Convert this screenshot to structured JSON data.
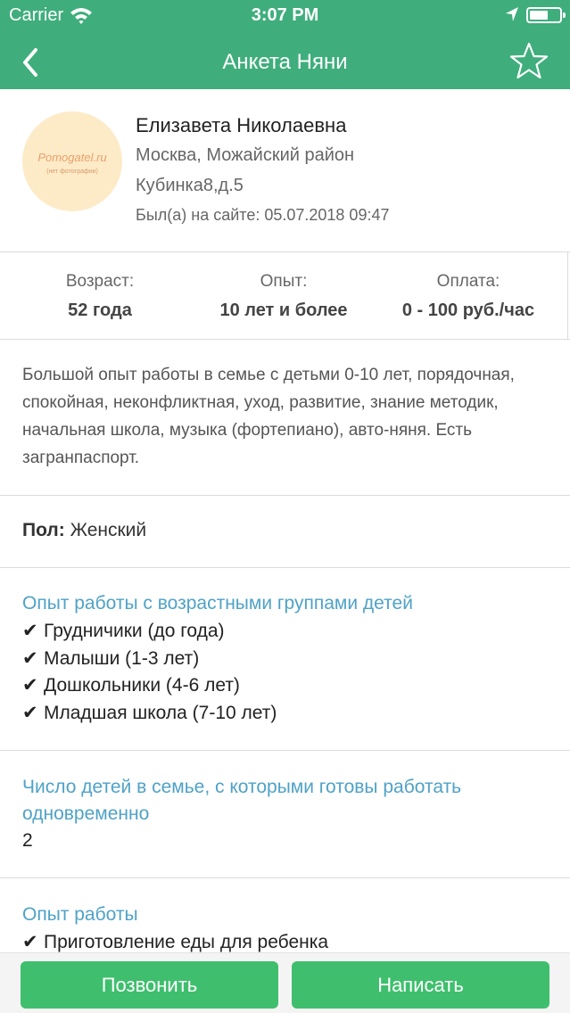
{
  "status_bar": {
    "carrier": "Carrier",
    "time": "3:07 PM"
  },
  "nav": {
    "title": "Анкета Няни",
    "back_icon": "chevron-left-icon",
    "favorite_icon": "star-outline-icon"
  },
  "profile": {
    "avatar_logo": "Pomogatel.ru",
    "avatar_sub": "(нет фотографии)",
    "name": "Елизавета Николаевна",
    "city": "Москва, Можайский район",
    "address": "Кубинка8,д.5",
    "last_seen_label": "Был(а) на сайте:",
    "last_seen_value": "05.07.2018 09:47"
  },
  "stats": {
    "age_label": "Возраст:",
    "age_value": "52 года",
    "experience_label": "Опыт:",
    "experience_value": "10 лет и более",
    "payment_label": "Оплата:",
    "payment_value": "0 - 100 руб./час"
  },
  "about": "Большой опыт работы в семье с детьми 0-10 лет, порядочная, спокойная, неконфликтная, уход, развитие, знание методик, начальная школа, музыка (фортепиано), авто-няня. Есть загранпаспорт.",
  "gender": {
    "label": "Пол:",
    "value": "Женский"
  },
  "age_groups": {
    "heading": "Опыт работы с возрастными группами детей",
    "check": "✔",
    "items": [
      "Грудничики (до года)",
      "Малыши (1-3 лет)",
      "Дошкольники (4-6 лет)",
      "Младшая школа (7-10 лет)"
    ]
  },
  "kids_count": {
    "heading": "Число детей в семье, с которыми готовы работать одновременно",
    "value": "2"
  },
  "work_experience": {
    "heading": "Опыт работы",
    "check": "✔",
    "items": [
      "Приготовление еды для ребенка"
    ]
  },
  "actions": {
    "call": "Позвонить",
    "write": "Написать"
  },
  "colors": {
    "header_green": "#3fae7c",
    "button_green": "#3fbf6e",
    "link_blue": "#4fa2c7"
  }
}
